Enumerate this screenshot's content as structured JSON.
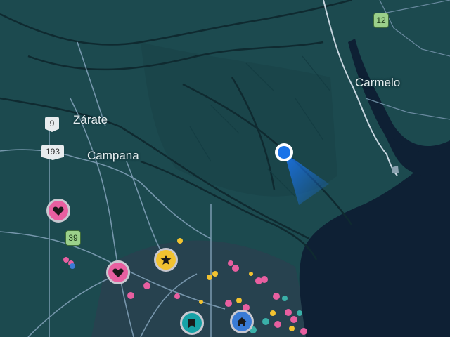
{
  "map": {
    "place_labels": {
      "zarate": "Zárate",
      "campana": "Campana",
      "carmelo": "Carmelo"
    },
    "route_shields": {
      "r9": "9",
      "r193": "193",
      "r39": "39",
      "r12": "12"
    },
    "icons": {
      "favorite": "heart-icon",
      "starred": "star-icon",
      "saved": "bookmark-icon",
      "home": "home-icon",
      "current_location": "location-dot-icon"
    },
    "colors": {
      "land": "#1c4a4f",
      "water": "#0e2034",
      "roads": "#7f9fb6",
      "location": "#1a73e8"
    }
  }
}
